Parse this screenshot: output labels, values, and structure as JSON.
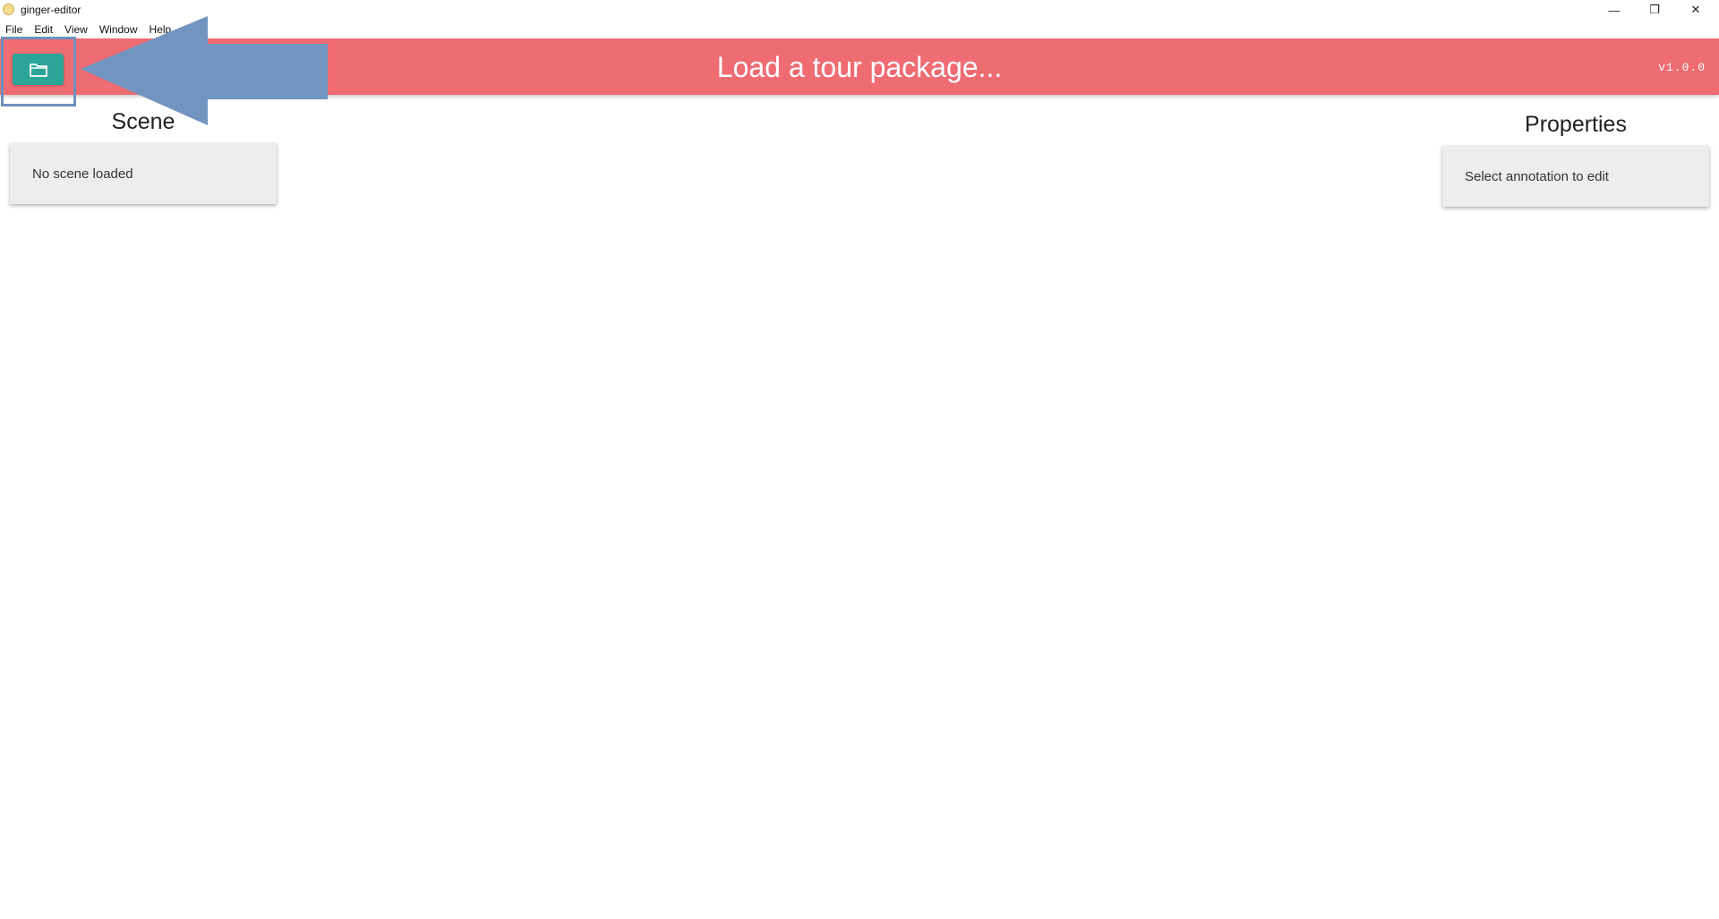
{
  "window": {
    "title": "ginger-editor",
    "controls": {
      "minimize": "—",
      "restore": "❐",
      "close": "✕"
    }
  },
  "menubar": {
    "items": [
      "File",
      "Edit",
      "View",
      "Window",
      "Help"
    ]
  },
  "header": {
    "title": "Load a tour package...",
    "version": "v1.0.0",
    "open_button_icon": "folder-icon",
    "background_color": "#ef6c73",
    "button_color": "#2ba598"
  },
  "annotation": {
    "arrow_color": "#7294c0",
    "box_color": "#6f8fbd"
  },
  "scene_panel": {
    "title": "Scene",
    "status": "No scene loaded"
  },
  "properties_panel": {
    "title": "Properties",
    "status": "Select annotation to edit"
  }
}
